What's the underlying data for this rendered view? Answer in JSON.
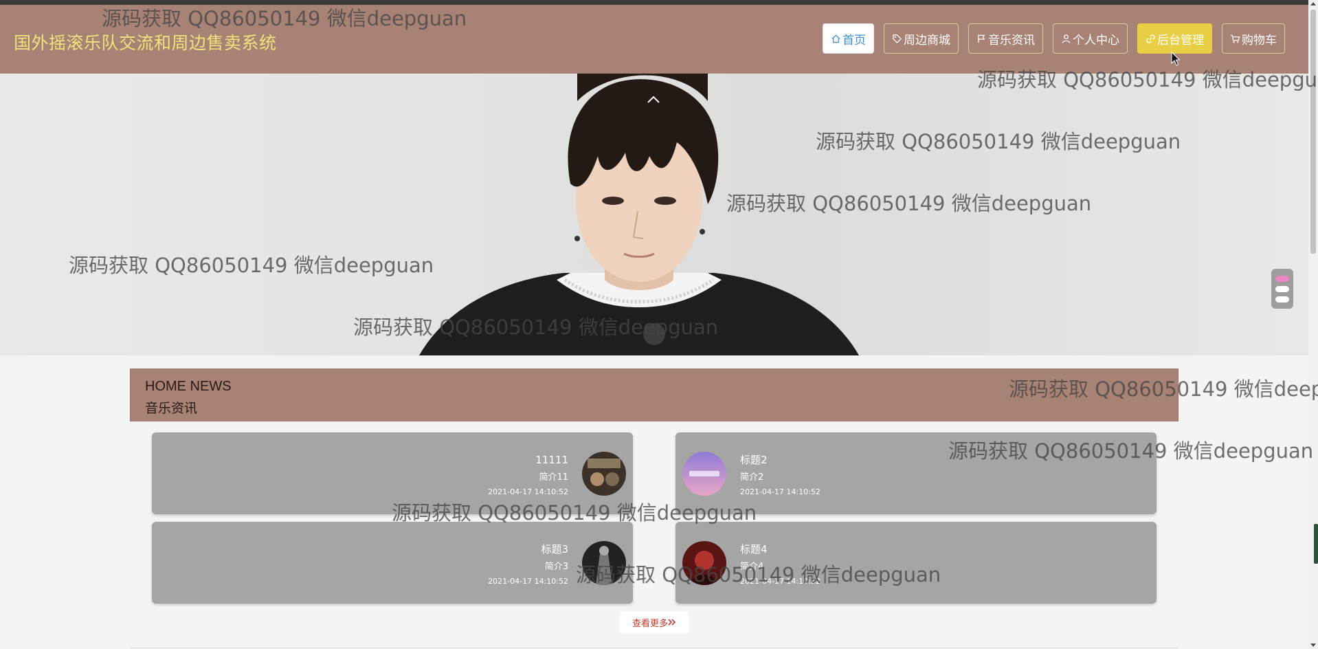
{
  "site": {
    "title": "国外摇滚乐队交流和周边售卖系统"
  },
  "nav": [
    {
      "label": "首页",
      "icon": "home-icon",
      "state": "active"
    },
    {
      "label": "周边商城",
      "icon": "tag-icon",
      "state": "normal"
    },
    {
      "label": "音乐资讯",
      "icon": "flag-icon",
      "state": "normal"
    },
    {
      "label": "个人中心",
      "icon": "user-icon",
      "state": "normal"
    },
    {
      "label": "后台管理",
      "icon": "link-icon",
      "state": "hover"
    },
    {
      "label": "购物车",
      "icon": "cart-icon",
      "state": "normal"
    }
  ],
  "colors": {
    "header_bg": "#a98276",
    "title_color": "#f5e07a",
    "active_nav_text": "#3a8fd1",
    "hover_nav_bg": "#e8cf45",
    "card_bg": "#a5a5a5",
    "more_text": "#c0392b"
  },
  "banner": {
    "slide_count": 3,
    "current_slide": 1
  },
  "news_section": {
    "title_en": "HOME NEWS",
    "title_cn": "音乐资讯",
    "items": [
      {
        "title": "11111",
        "summary": "简介11",
        "date": "2021-04-17 14:10:52"
      },
      {
        "title": "标题2",
        "summary": "简介2",
        "date": "2021-04-17 14:10:52"
      },
      {
        "title": "标题3",
        "summary": "简介3",
        "date": "2021-04-17 14:10:52"
      },
      {
        "title": "标题4",
        "summary": "简介4",
        "date": "2021-04-17 14:10:52"
      }
    ],
    "more_label": "查看更多"
  },
  "watermark": {
    "text": "源码获取 QQ86050149 微信deepguan"
  }
}
